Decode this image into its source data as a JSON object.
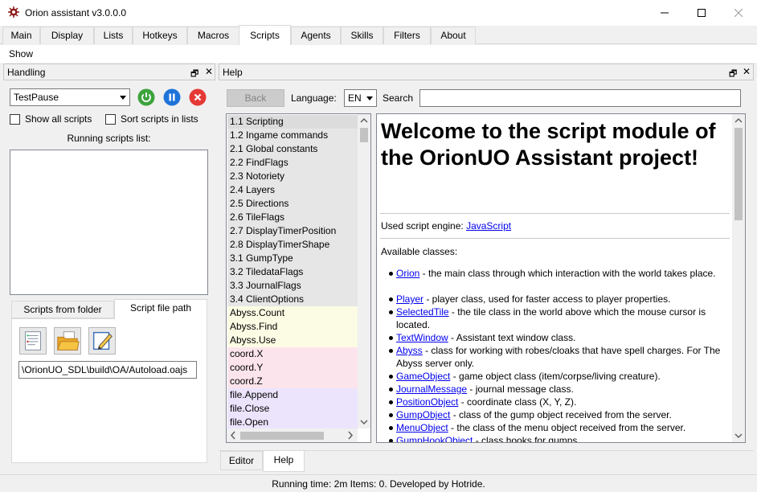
{
  "window": {
    "title": "Orion assistant v3.0.0.0"
  },
  "menu_tabs": [
    "Main",
    "Display",
    "Lists",
    "Hotkeys",
    "Macros",
    "Scripts",
    "Agents",
    "Skills",
    "Filters",
    "About"
  ],
  "active_menu_tab": "Scripts",
  "show_label": "Show",
  "handling": {
    "title": "Handling",
    "script_combo": "TestPause",
    "show_all_scripts": "Show all scripts",
    "sort_scripts": "Sort scripts in lists",
    "running_label": "Running scripts list:",
    "tab_folder": "Scripts from folder",
    "tab_path": "Script file path",
    "path_value": "\\OrionUO_SDL\\build\\OA/Autoload.oajs"
  },
  "help": {
    "title": "Help",
    "back": "Back",
    "language_label": "Language:",
    "language_value": "EN",
    "search_label": "Search",
    "search_value": "",
    "toc": [
      {
        "label": "1.1 Scripting",
        "color": "#dcdcdc"
      },
      {
        "label": "1.2 Ingame commands",
        "color": "#e6e6e6"
      },
      {
        "label": "2.1 Global constants",
        "color": "#e6e6e6"
      },
      {
        "label": "2.2 FindFlags",
        "color": "#e6e6e6"
      },
      {
        "label": "2.3 Notoriety",
        "color": "#e6e6e6"
      },
      {
        "label": "2.4 Layers",
        "color": "#e6e6e6"
      },
      {
        "label": "2.5 Directions",
        "color": "#e6e6e6"
      },
      {
        "label": "2.6 TileFlags",
        "color": "#e6e6e6"
      },
      {
        "label": "2.7 DisplayTimerPosition",
        "color": "#e6e6e6"
      },
      {
        "label": "2.8 DisplayTimerShape",
        "color": "#e6e6e6"
      },
      {
        "label": "3.1 GumpType",
        "color": "#e6e6e6"
      },
      {
        "label": "3.2 TiledataFlags",
        "color": "#e6e6e6"
      },
      {
        "label": "3.3 JournalFlags",
        "color": "#e6e6e6"
      },
      {
        "label": "3.4 ClientOptions",
        "color": "#e6e6e6"
      },
      {
        "label": "Abyss.Count",
        "color": "#fcfce4"
      },
      {
        "label": "Abyss.Find",
        "color": "#fcfce4"
      },
      {
        "label": "Abyss.Use",
        "color": "#fcfce4"
      },
      {
        "label": "coord.X",
        "color": "#fce4ec"
      },
      {
        "label": "coord.Y",
        "color": "#fce4ec"
      },
      {
        "label": "coord.Z",
        "color": "#fce4ec"
      },
      {
        "label": "file.Append",
        "color": "#ece4fc"
      },
      {
        "label": "file.Close",
        "color": "#ece4fc"
      },
      {
        "label": "file.Open",
        "color": "#ece4fc"
      }
    ],
    "heading": "Welcome to the script module of the OrionUO Assistant project!",
    "engine_label": "Used script engine:",
    "engine_link": "JavaScript",
    "classes_label": "Available classes:",
    "classes": [
      {
        "name": "Orion",
        "desc": " - the main class through which interaction with the world takes place."
      },
      {
        "name": "Player",
        "desc": " - player class, used for faster access to player properties."
      },
      {
        "name": "SelectedTile",
        "desc": " - the tile class in the world above which the mouse cursor is located."
      },
      {
        "name": "TextWindow",
        "desc": " - Assistant text window class."
      },
      {
        "name": "Abyss",
        "desc": " - class for working with robes/cloaks that have spell charges. For The Abyss server only."
      },
      {
        "name": "GameObject",
        "desc": " - game object class (item/corpse/living creature)."
      },
      {
        "name": "JournalMessage",
        "desc": " - journal message class."
      },
      {
        "name": "PositionObject",
        "desc": " - coordinate class (X, Y, Z)."
      },
      {
        "name": "GumpObject",
        "desc": " - class of the gump object received from the server."
      },
      {
        "name": "MenuObject",
        "desc": " - the class of the menu object received from the server."
      },
      {
        "name": "GumpHookObject",
        "desc": " - class hooks for gumps."
      }
    ],
    "bottom_tabs": [
      "Editor",
      "Help"
    ],
    "active_bottom_tab": "Help"
  },
  "status": "Running time: 2m Items: 0. Developed by Hotride.",
  "colors": {
    "power_green": "#3ca33c",
    "pause_blue": "#1e74d8",
    "stop_red": "#e53935",
    "link": "#0000ee"
  }
}
